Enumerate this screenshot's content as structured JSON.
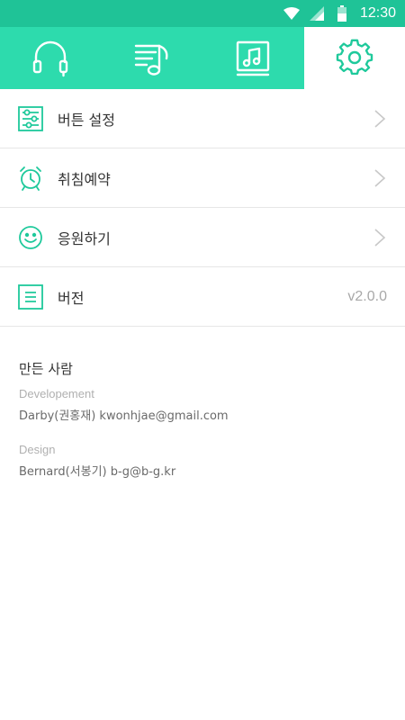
{
  "status_bar": {
    "time": "12:30",
    "icons": [
      "wifi-icon",
      "signal-icon",
      "battery-icon"
    ]
  },
  "colors": {
    "accent": "#2ddbad",
    "accent_dark": "#1fc397",
    "icon_green": "#1ec99b"
  },
  "tabs": [
    {
      "name": "headphones",
      "icon": "headphones-icon",
      "active": false
    },
    {
      "name": "playlist",
      "icon": "playlist-icon",
      "active": false
    },
    {
      "name": "album",
      "icon": "music-album-icon",
      "active": false
    },
    {
      "name": "settings",
      "icon": "gear-icon",
      "active": true
    }
  ],
  "settings": {
    "items": [
      {
        "label": "버튼 설정",
        "icon": "sliders-icon",
        "chevron": true
      },
      {
        "label": "취침예약",
        "icon": "alarm-clock-icon",
        "chevron": true
      },
      {
        "label": "응원하기",
        "icon": "smiley-icon",
        "chevron": true
      },
      {
        "label": "버전",
        "icon": "document-icon",
        "value": "v2.0.0"
      }
    ]
  },
  "credits": {
    "title": "만든 사람",
    "development_label": "Developement",
    "development_person": "Darby(권홍재) kwonhjae@gmail.com",
    "design_label": "Design",
    "design_person": "Bernard(서봉기) b-g@b-g.kr"
  }
}
